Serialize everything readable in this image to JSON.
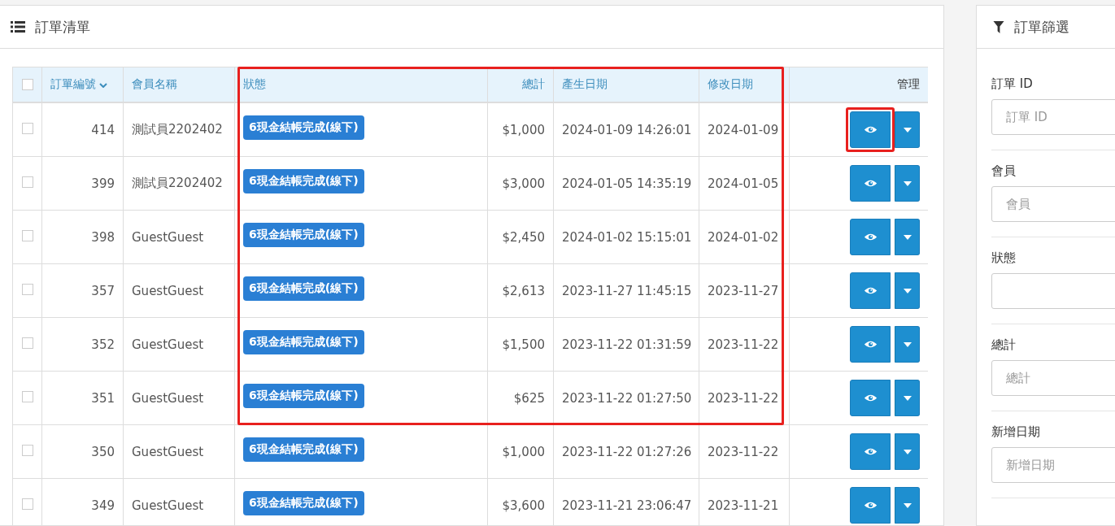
{
  "list_panel": {
    "title": "訂單清單"
  },
  "table": {
    "header_checked": false,
    "columns": [
      {
        "kind": "checkbox",
        "marked": false
      },
      {
        "label": "訂單編號",
        "kind": "sort",
        "marked": false
      },
      {
        "label": "會員名稱",
        "kind": "text",
        "marked": false
      },
      {
        "label": "狀態",
        "kind": "text",
        "marked": true
      },
      {
        "label": "總計",
        "kind": "num",
        "marked": true
      },
      {
        "label": "產生日期",
        "kind": "text",
        "marked": true
      },
      {
        "label": "修改日期",
        "kind": "text",
        "marked": true
      },
      {
        "label": "管理",
        "kind": "manage",
        "marked": false
      }
    ],
    "rows": [
      {
        "checked": false,
        "id": "414",
        "member": "測試員2202402",
        "status": "6現金結帳完成(線下)",
        "total": "$1,000",
        "created": "2024-01-09 14:26:01",
        "modified": "2024-01-09",
        "marked": true,
        "view_marked": true
      },
      {
        "checked": false,
        "id": "399",
        "member": "測試員2202402",
        "status": "6現金結帳完成(線下)",
        "total": "$3,000",
        "created": "2024-01-05 14:35:19",
        "modified": "2024-01-05",
        "marked": true,
        "view_marked": false
      },
      {
        "checked": false,
        "id": "398",
        "member": "GuestGuest",
        "status": "6現金結帳完成(線下)",
        "total": "$2,450",
        "created": "2024-01-02 15:15:01",
        "modified": "2024-01-02",
        "marked": true,
        "view_marked": false
      },
      {
        "checked": false,
        "id": "357",
        "member": "GuestGuest",
        "status": "6現金結帳完成(線下)",
        "total": "$2,613",
        "created": "2023-11-27 11:45:15",
        "modified": "2023-11-27",
        "marked": true,
        "view_marked": false
      },
      {
        "checked": false,
        "id": "352",
        "member": "GuestGuest",
        "status": "6現金結帳完成(線下)",
        "total": "$1,500",
        "created": "2023-11-22 01:31:59",
        "modified": "2023-11-22",
        "marked": true,
        "view_marked": false
      },
      {
        "checked": false,
        "id": "351",
        "member": "GuestGuest",
        "status": "6現金結帳完成(線下)",
        "total": "$625",
        "created": "2023-11-22 01:27:50",
        "modified": "2023-11-22",
        "marked": true,
        "view_marked": false
      },
      {
        "checked": false,
        "id": "350",
        "member": "GuestGuest",
        "status": "6現金結帳完成(線下)",
        "total": "$1,000",
        "created": "2023-11-22 01:27:26",
        "modified": "2023-11-22",
        "marked": false,
        "view_marked": false
      },
      {
        "checked": false,
        "id": "349",
        "member": "GuestGuest",
        "status": "6現金結帳完成(線下)",
        "total": "$3,600",
        "created": "2023-11-21 23:06:47",
        "modified": "2023-11-21",
        "marked": false,
        "view_marked": false
      }
    ]
  },
  "filter_panel": {
    "title": "訂單篩選",
    "fields": [
      {
        "label": "訂單 ID",
        "kind": "input",
        "placeholder": "訂單 ID"
      },
      {
        "label": "會員",
        "kind": "input",
        "placeholder": "會員"
      },
      {
        "label": "狀態",
        "kind": "select"
      },
      {
        "label": "總計",
        "kind": "input",
        "placeholder": "總計"
      },
      {
        "label": "新增日期",
        "kind": "input",
        "placeholder": "新增日期"
      }
    ]
  }
}
